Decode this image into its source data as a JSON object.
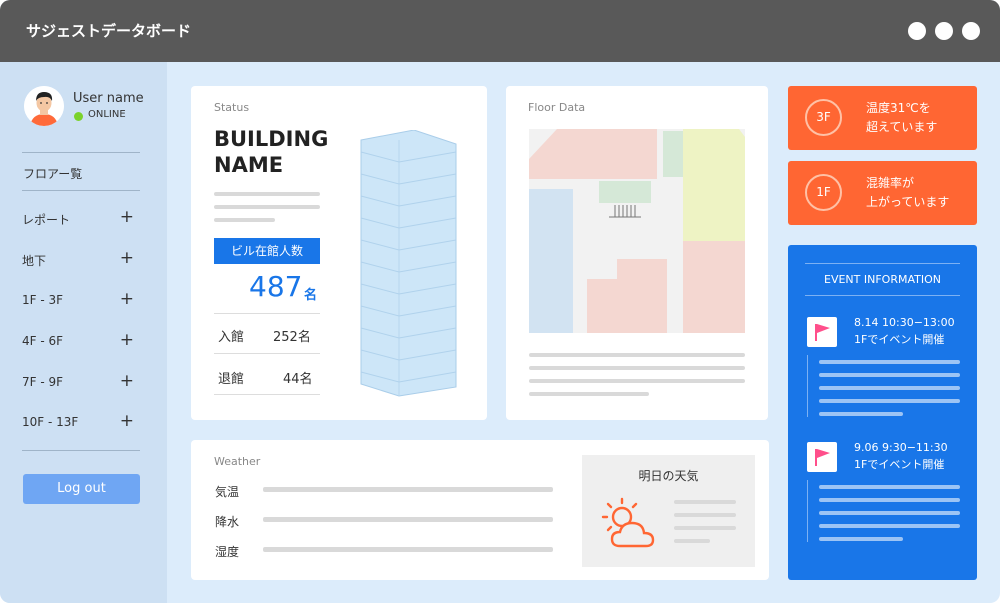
{
  "window": {
    "title": "サジェストデータボード"
  },
  "user": {
    "name": "User name",
    "status": "ONLINE"
  },
  "sidebar": {
    "floor_list_label": "フロアー覧",
    "items": [
      {
        "label": "レポート"
      },
      {
        "label": "地下"
      },
      {
        "label": "1F - 3F"
      },
      {
        "label": "4F - 6F"
      },
      {
        "label": "7F - 9F"
      },
      {
        "label": "10F - 13F"
      }
    ],
    "logout_label": "Log out"
  },
  "status_card": {
    "label": "Status",
    "building_name_line1": "BUILDING",
    "building_name_line2": "NAME",
    "occupancy_label": "ビル在館人数",
    "occupancy_count": "487",
    "occupancy_unit": "名",
    "entered_label": "入館",
    "entered_value": "252名",
    "exited_label": "退館",
    "exited_value": "44名"
  },
  "floor_card": {
    "label": "Floor Data"
  },
  "weather_card": {
    "label": "Weather",
    "rows": [
      {
        "label": "気温"
      },
      {
        "label": "降水"
      },
      {
        "label": "湿度"
      }
    ],
    "forecast_title": "明日の天気",
    "forecast_icon": "partly-cloudy-icon"
  },
  "alerts": [
    {
      "floor": "3F",
      "line1": "温度31℃を",
      "line2": "超えています"
    },
    {
      "floor": "1F",
      "line1": "混雑率が",
      "line2": "上がっています"
    }
  ],
  "events": {
    "title": "EVENT INFORMATION",
    "items": [
      {
        "line1": "8.14 10:30−13:00",
        "line2": "1Fでイベント開催"
      },
      {
        "line1": "9.06  9:30−11:30",
        "line2": "1Fでイベント開催"
      }
    ]
  },
  "colors": {
    "accent_blue": "#1976e8",
    "alert_orange": "#ff6633",
    "online_green": "#7bd22b",
    "sidebar_bg": "#cde0f3",
    "titlebar_bg": "#595959"
  }
}
